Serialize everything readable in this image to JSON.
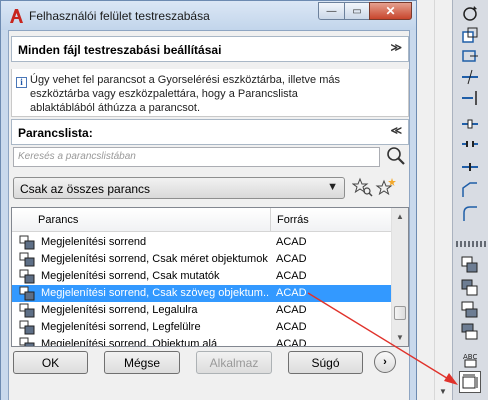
{
  "window": {
    "title": "Felhasználói felület testreszabása",
    "minimize_glyph": "—",
    "maximize_glyph": "▭",
    "close_glyph": "✕"
  },
  "customize_panel": {
    "title": "Minden fájl testreszabási beállításai",
    "collapse_glyph": "≫"
  },
  "info": {
    "icon": "info-icon",
    "line1": "Úgy vehet fel parancsot a Gyorselérési eszköztárba, illetve más",
    "line2": "eszköztárba vagy eszközpalettára, hogy a Parancslista",
    "line3": "ablaktáblából áthúzza a parancsot."
  },
  "command_list_panel": {
    "title": "Parancslista:",
    "collapse_glyph": "≪"
  },
  "search": {
    "placeholder": "Keresés a parancslistában"
  },
  "filter": {
    "selected": "Csak az összes parancs",
    "arrow": "▼"
  },
  "list": {
    "columns": [
      "Parancs",
      "Forrás"
    ],
    "rows": [
      {
        "name": "Megjelenítési sorrend",
        "source": "ACAD"
      },
      {
        "name": "Megjelenítési sorrend, Csak méret objektumok",
        "source": "ACAD"
      },
      {
        "name": "Megjelenítési sorrend, Csak mutatók",
        "source": "ACAD"
      },
      {
        "name": "Megjelenítési sorrend, Csak szöveg objektum...",
        "source": "ACAD",
        "selected": true
      },
      {
        "name": "Megjelenítési sorrend, Legalulra",
        "source": "ACAD"
      },
      {
        "name": "Megjelenítési sorrend, Legfelülre",
        "source": "ACAD"
      },
      {
        "name": "Megjelenítési sorrend, Objektum alá",
        "source": "ACAD"
      }
    ]
  },
  "buttons": {
    "ok": "OK",
    "cancel": "Mégse",
    "apply": "Alkalmaz",
    "help": "Súgó",
    "next_glyph": "›"
  },
  "colors": {
    "selection": "#3399ff",
    "annotation_arrow": "#e0322b",
    "title_bar": "#c9d9ec"
  }
}
